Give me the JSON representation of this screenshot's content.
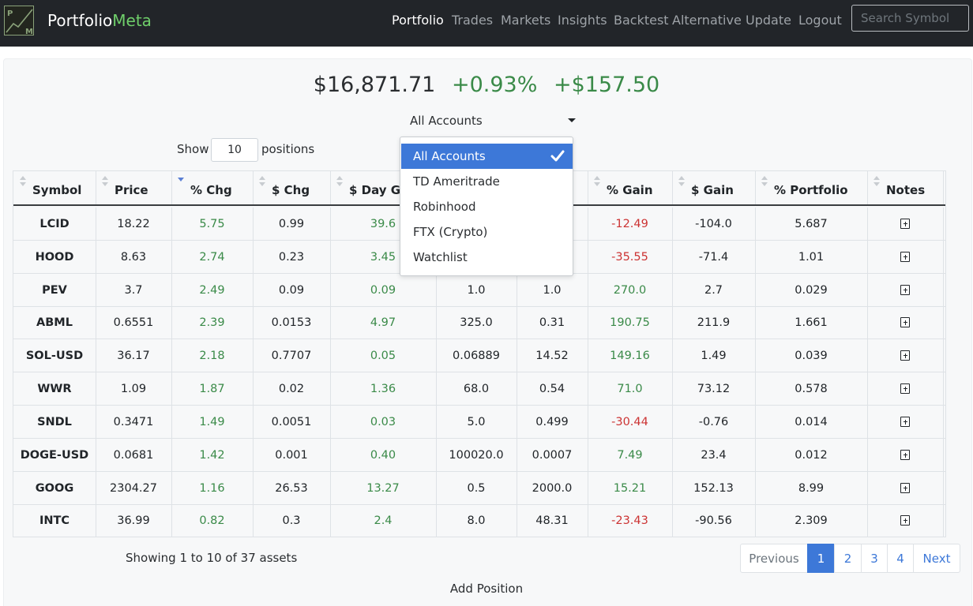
{
  "brand": {
    "part1": "Portfolio",
    "part2": "Meta",
    "logo_text_top": "P",
    "logo_text_bottom": "M"
  },
  "nav": [
    {
      "label": "Portfolio",
      "active": true
    },
    {
      "label": "Trades"
    },
    {
      "label": "Markets"
    },
    {
      "label": "Insights"
    },
    {
      "label": "Backtest"
    },
    {
      "label": "Alternative"
    },
    {
      "label": "Update"
    },
    {
      "label": "Logout"
    }
  ],
  "search": {
    "placeholder": "Search Symbol"
  },
  "summary": {
    "total": "$16,871.71",
    "pct_change": "+0.93%",
    "dollar_change": "+$157.50"
  },
  "account_select": {
    "selected": "All Accounts",
    "options": [
      "All Accounts",
      "TD Ameritrade",
      "Robinhood",
      "FTX (Crypto)",
      "Watchlist"
    ]
  },
  "show": {
    "prefix": "Show",
    "value": "10",
    "suffix": "positions"
  },
  "table": {
    "headers": [
      "Symbol",
      "Price",
      "% Chg",
      "$ Chg",
      "$ Day Ga",
      "",
      "",
      "% Gain",
      "$ Gain",
      "% Portfolio",
      "Notes"
    ],
    "rows": [
      [
        "LCID",
        "18.22",
        "5.75",
        "0.99",
        "39.6",
        "",
        "",
        "-12.49",
        "-104.0",
        "5.687",
        ""
      ],
      [
        "HOOD",
        "8.63",
        "2.74",
        "0.23",
        "3.45",
        "",
        "",
        "-35.55",
        "-71.4",
        "1.01",
        ""
      ],
      [
        "PEV",
        "3.7",
        "2.49",
        "0.09",
        "0.09",
        "1.0",
        "1.0",
        "270.0",
        "2.7",
        "0.029",
        ""
      ],
      [
        "ABML",
        "0.6551",
        "2.39",
        "0.0153",
        "4.97",
        "325.0",
        "0.31",
        "190.75",
        "211.9",
        "1.661",
        ""
      ],
      [
        "SOL-USD",
        "36.17",
        "2.18",
        "0.7707",
        "0.05",
        "0.06889",
        "14.52",
        "149.16",
        "1.49",
        "0.039",
        ""
      ],
      [
        "WWR",
        "1.09",
        "1.87",
        "0.02",
        "1.36",
        "68.0",
        "0.54",
        "71.0",
        "73.12",
        "0.578",
        ""
      ],
      [
        "SNDL",
        "0.3471",
        "1.49",
        "0.0051",
        "0.03",
        "5.0",
        "0.499",
        "-30.44",
        "-0.76",
        "0.014",
        ""
      ],
      [
        "DOGE-USD",
        "0.0681",
        "1.42",
        "0.001",
        "0.40",
        "100020.0",
        "0.0007",
        "7.49",
        "23.4",
        "0.012",
        ""
      ],
      [
        "GOOG",
        "2304.27",
        "1.16",
        "26.53",
        "13.27",
        "0.5",
        "2000.0",
        "15.21",
        "152.13",
        "8.99",
        ""
      ],
      [
        "INTC",
        "36.99",
        "0.82",
        "0.3",
        "2.4",
        "8.0",
        "48.31",
        "-23.43",
        "-90.56",
        "2.309",
        ""
      ]
    ]
  },
  "footer": {
    "showing": "Showing 1 to 10 of 37 assets",
    "pages": [
      "Previous",
      "1",
      "2",
      "3",
      "4",
      "Next"
    ],
    "active_page": "1",
    "add_position": "Add Position"
  },
  "colors": {
    "navbar": "#222529",
    "accent": "#3d78d8",
    "gain": "#3a8a48",
    "loss": "#cc3333",
    "brand_accent": "#6fcf6a"
  }
}
